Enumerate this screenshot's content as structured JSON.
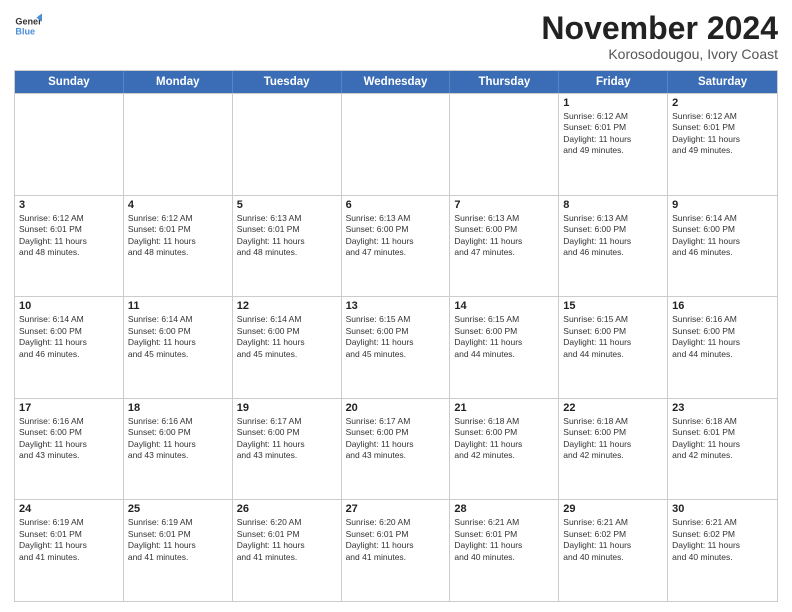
{
  "logo": {
    "line1": "General",
    "line2": "Blue"
  },
  "title": "November 2024",
  "location": "Korosodougou, Ivory Coast",
  "weekdays": [
    "Sunday",
    "Monday",
    "Tuesday",
    "Wednesday",
    "Thursday",
    "Friday",
    "Saturday"
  ],
  "rows": [
    [
      {
        "day": "",
        "text": ""
      },
      {
        "day": "",
        "text": ""
      },
      {
        "day": "",
        "text": ""
      },
      {
        "day": "",
        "text": ""
      },
      {
        "day": "",
        "text": ""
      },
      {
        "day": "1",
        "text": "Sunrise: 6:12 AM\nSunset: 6:01 PM\nDaylight: 11 hours\nand 49 minutes."
      },
      {
        "day": "2",
        "text": "Sunrise: 6:12 AM\nSunset: 6:01 PM\nDaylight: 11 hours\nand 49 minutes."
      }
    ],
    [
      {
        "day": "3",
        "text": "Sunrise: 6:12 AM\nSunset: 6:01 PM\nDaylight: 11 hours\nand 48 minutes."
      },
      {
        "day": "4",
        "text": "Sunrise: 6:12 AM\nSunset: 6:01 PM\nDaylight: 11 hours\nand 48 minutes."
      },
      {
        "day": "5",
        "text": "Sunrise: 6:13 AM\nSunset: 6:01 PM\nDaylight: 11 hours\nand 48 minutes."
      },
      {
        "day": "6",
        "text": "Sunrise: 6:13 AM\nSunset: 6:00 PM\nDaylight: 11 hours\nand 47 minutes."
      },
      {
        "day": "7",
        "text": "Sunrise: 6:13 AM\nSunset: 6:00 PM\nDaylight: 11 hours\nand 47 minutes."
      },
      {
        "day": "8",
        "text": "Sunrise: 6:13 AM\nSunset: 6:00 PM\nDaylight: 11 hours\nand 46 minutes."
      },
      {
        "day": "9",
        "text": "Sunrise: 6:14 AM\nSunset: 6:00 PM\nDaylight: 11 hours\nand 46 minutes."
      }
    ],
    [
      {
        "day": "10",
        "text": "Sunrise: 6:14 AM\nSunset: 6:00 PM\nDaylight: 11 hours\nand 46 minutes."
      },
      {
        "day": "11",
        "text": "Sunrise: 6:14 AM\nSunset: 6:00 PM\nDaylight: 11 hours\nand 45 minutes."
      },
      {
        "day": "12",
        "text": "Sunrise: 6:14 AM\nSunset: 6:00 PM\nDaylight: 11 hours\nand 45 minutes."
      },
      {
        "day": "13",
        "text": "Sunrise: 6:15 AM\nSunset: 6:00 PM\nDaylight: 11 hours\nand 45 minutes."
      },
      {
        "day": "14",
        "text": "Sunrise: 6:15 AM\nSunset: 6:00 PM\nDaylight: 11 hours\nand 44 minutes."
      },
      {
        "day": "15",
        "text": "Sunrise: 6:15 AM\nSunset: 6:00 PM\nDaylight: 11 hours\nand 44 minutes."
      },
      {
        "day": "16",
        "text": "Sunrise: 6:16 AM\nSunset: 6:00 PM\nDaylight: 11 hours\nand 44 minutes."
      }
    ],
    [
      {
        "day": "17",
        "text": "Sunrise: 6:16 AM\nSunset: 6:00 PM\nDaylight: 11 hours\nand 43 minutes."
      },
      {
        "day": "18",
        "text": "Sunrise: 6:16 AM\nSunset: 6:00 PM\nDaylight: 11 hours\nand 43 minutes."
      },
      {
        "day": "19",
        "text": "Sunrise: 6:17 AM\nSunset: 6:00 PM\nDaylight: 11 hours\nand 43 minutes."
      },
      {
        "day": "20",
        "text": "Sunrise: 6:17 AM\nSunset: 6:00 PM\nDaylight: 11 hours\nand 43 minutes."
      },
      {
        "day": "21",
        "text": "Sunrise: 6:18 AM\nSunset: 6:00 PM\nDaylight: 11 hours\nand 42 minutes."
      },
      {
        "day": "22",
        "text": "Sunrise: 6:18 AM\nSunset: 6:00 PM\nDaylight: 11 hours\nand 42 minutes."
      },
      {
        "day": "23",
        "text": "Sunrise: 6:18 AM\nSunset: 6:01 PM\nDaylight: 11 hours\nand 42 minutes."
      }
    ],
    [
      {
        "day": "24",
        "text": "Sunrise: 6:19 AM\nSunset: 6:01 PM\nDaylight: 11 hours\nand 41 minutes."
      },
      {
        "day": "25",
        "text": "Sunrise: 6:19 AM\nSunset: 6:01 PM\nDaylight: 11 hours\nand 41 minutes."
      },
      {
        "day": "26",
        "text": "Sunrise: 6:20 AM\nSunset: 6:01 PM\nDaylight: 11 hours\nand 41 minutes."
      },
      {
        "day": "27",
        "text": "Sunrise: 6:20 AM\nSunset: 6:01 PM\nDaylight: 11 hours\nand 41 minutes."
      },
      {
        "day": "28",
        "text": "Sunrise: 6:21 AM\nSunset: 6:01 PM\nDaylight: 11 hours\nand 40 minutes."
      },
      {
        "day": "29",
        "text": "Sunrise: 6:21 AM\nSunset: 6:02 PM\nDaylight: 11 hours\nand 40 minutes."
      },
      {
        "day": "30",
        "text": "Sunrise: 6:21 AM\nSunset: 6:02 PM\nDaylight: 11 hours\nand 40 minutes."
      }
    ]
  ]
}
